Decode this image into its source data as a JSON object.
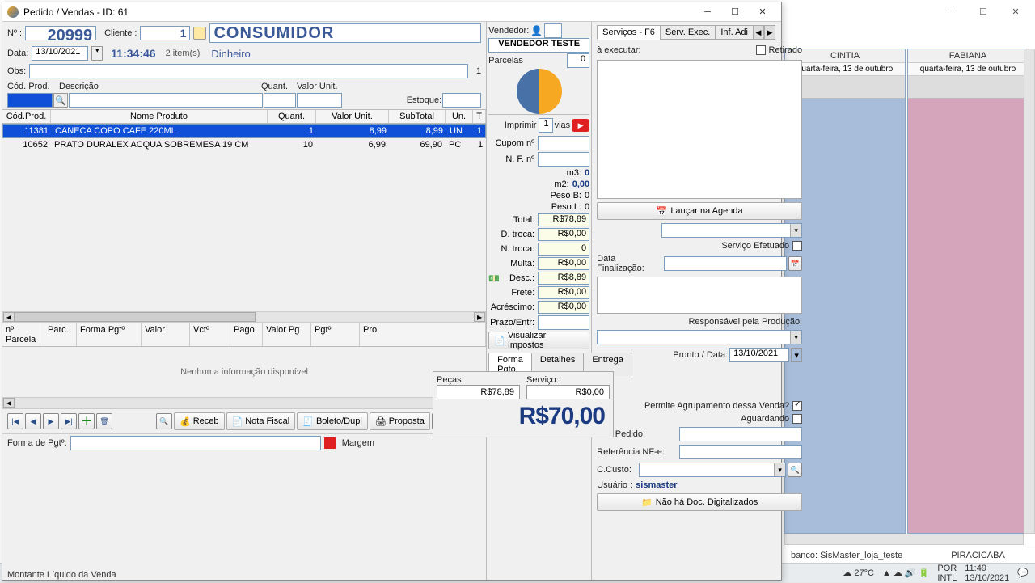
{
  "window": {
    "title": "Pedido / Vendas - ID: 61"
  },
  "header": {
    "numero_label": "Nº :",
    "numero": "20999",
    "cliente_label": "Cliente :",
    "cliente_id": "1",
    "cliente_nome": "CONSUMIDOR",
    "data_label": "Data:",
    "data": "13/10/2021",
    "hora": "11:34:46",
    "itens": "2 item(s)",
    "pagamento": "Dinheiro",
    "obs_label": "Obs:",
    "obs_count": "1",
    "vendedor_label": "Vendedor:",
    "vendedor_nome": "VENDEDOR TESTE",
    "parcelas_label": "Parcelas",
    "parcelas": "0"
  },
  "search_labels": {
    "cod": "Cód. Prod.",
    "desc": "Descrição",
    "quant": "Quant.",
    "valor": "Valor Unit.",
    "estoque": "Estoque:"
  },
  "grid": {
    "cols": [
      "Cód.Prod.",
      "Nome Produto",
      "Quant.",
      "Valor Unit.",
      "SubTotal",
      "Un.",
      "T"
    ],
    "rows": [
      {
        "cod": "11381",
        "nome": "CANECA COPO CAFE 220ML",
        "q": "1",
        "vu": "8,99",
        "st": "8,99",
        "un": "UN",
        "t": "1",
        "sel": true
      },
      {
        "cod": "10652",
        "nome": "PRATO DURALEX ACQUA SOBREMESA 19 CM",
        "q": "10",
        "vu": "6,99",
        "st": "69,90",
        "un": "PC",
        "t": "1",
        "sel": false
      }
    ]
  },
  "parcelas_grid": {
    "cols": [
      "nº Parcela",
      "Parc.",
      "Forma Pgtº",
      "Valor",
      "Vctº",
      "Pago",
      "Valor Pg",
      "Pgtº",
      "Pro"
    ],
    "empty": "Nenhuma informação disponível"
  },
  "toolbar": {
    "receb": "Receb",
    "nota": "Nota Fiscal",
    "boleto": "Boleto/Dupl",
    "proposta": "Proposta",
    "forma_label": "Forma de Pgtº:",
    "margem": "Margem"
  },
  "totals": {
    "imprimir": "Imprimir",
    "vias": "vias",
    "vias_n": "1",
    "cupom": "Cupom nº",
    "nf": "N. F. nº",
    "m3": "m3:",
    "m3v": "0",
    "m2": "m2:",
    "m2v": "0,00",
    "pesob": "Peso B:",
    "pesobv": "0",
    "pesol": "Peso L:",
    "pesolv": "0",
    "total": "Total:",
    "totalv": "R$78,89",
    "dtroca": "D. troca:",
    "dtrocav": "R$0,00",
    "ntroca": "N. troca:",
    "ntrocav": "0",
    "multa": "Multa:",
    "multav": "R$0,00",
    "desc": "Desc.:",
    "descv": "R$8,89",
    "frete": "Frete:",
    "fretev": "R$0,00",
    "acresc": "Acréscimo:",
    "acrescv": "R$0,00",
    "prazo": "Prazo/Entr:",
    "impostos": "Visualizar Impostos"
  },
  "tabs": {
    "forma": "Forma Pgto.",
    "detalhes": "Detalhes",
    "entrega": "Entrega",
    "pecas": "Peças:",
    "pecasv": "R$78,89",
    "servico": "Serviço:",
    "servicov": "R$0,00",
    "grand": "R$70,00"
  },
  "svc": {
    "t1": "Serviços - F6",
    "t2": "Serv. Exec.",
    "t3": "Inf. Adi",
    "exec": "à executar:",
    "retirado": "Retirado",
    "agenda_btn": "Lançar na Agenda",
    "efetuado": "Serviço Efetuado",
    "datafin": "Data Finalização:",
    "resp": "Responsável pela Produção:",
    "pronto": "Pronto / Data:",
    "pronto_v": "13/10/2021",
    "permite": "Permite Agrupamento dessa Venda?",
    "aguard": "Aguardando",
    "seupedido": "Seu Pedido:",
    "refnfe": "Referência NF-e:",
    "ccusto": "C.Custo:",
    "usuario": "Usuário :",
    "usuario_v": "sismaster",
    "docs": "Não há Doc. Digitalizados"
  },
  "agenda": {
    "c1": "CINTIA",
    "c2": "FABIANA",
    "sub": "quarta-feira, 13 de outubro"
  },
  "footer": {
    "banco": "banco: SisMaster_loja_teste",
    "cidade": "PIRACICABA",
    "montante": "Montante Líquido da Venda"
  },
  "taskbar": {
    "temp": "27°C",
    "lang1": "POR",
    "lang2": "INTL",
    "time": "11:49",
    "date": "13/10/2021"
  }
}
